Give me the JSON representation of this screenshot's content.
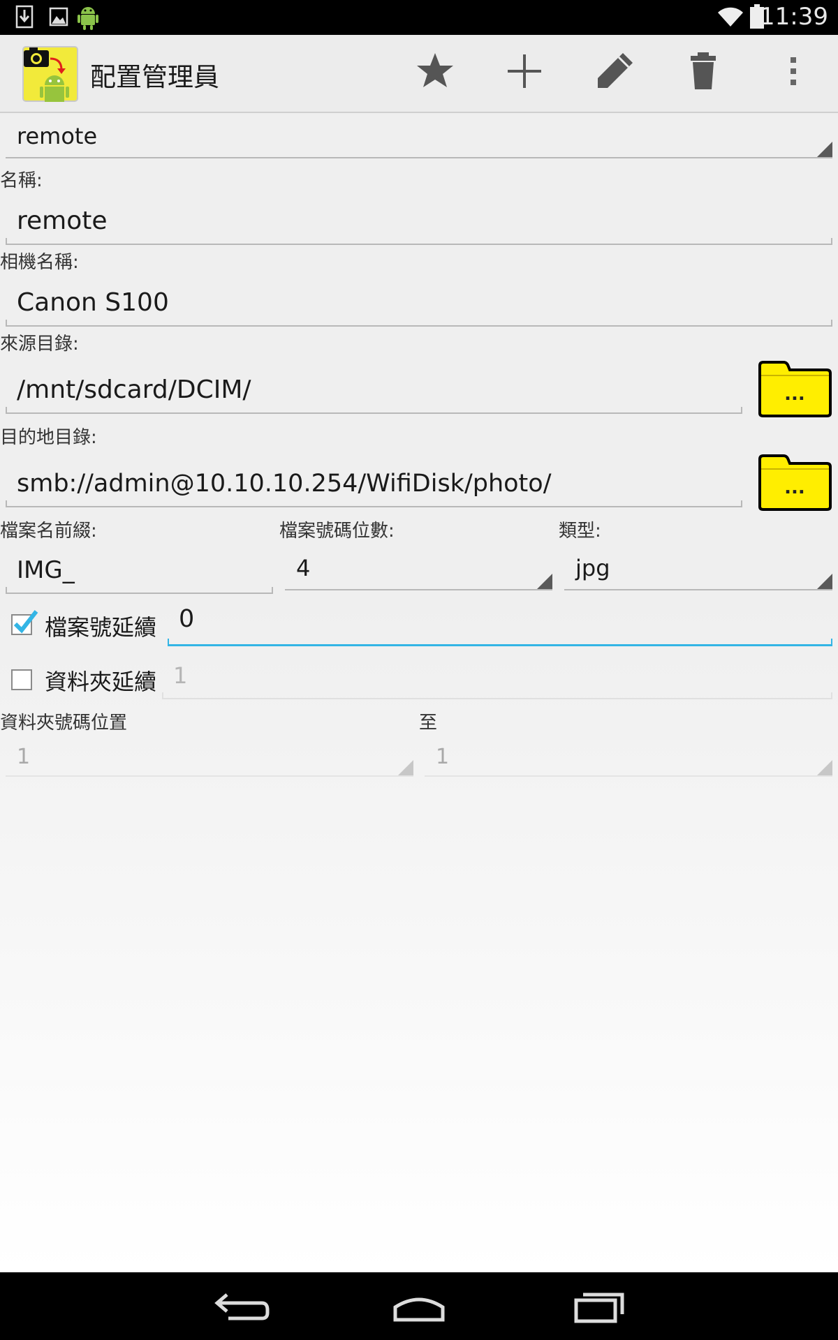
{
  "status_bar": {
    "time": "11:39",
    "icons": [
      "download-icon",
      "image-icon",
      "android-icon",
      "wifi-icon",
      "battery-icon"
    ]
  },
  "action_bar": {
    "title": "配置管理員",
    "icons": [
      "favorite-star-icon",
      "add-icon",
      "edit-pencil-icon",
      "delete-trash-icon",
      "overflow-menu-icon"
    ]
  },
  "profile_selector": {
    "value": "remote"
  },
  "form": {
    "name_label": "名稱:",
    "name_value": "remote",
    "camera_label": "相機名稱:",
    "camera_value": "Canon S100",
    "source_label": "來源目錄:",
    "source_value": "/mnt/sdcard/DCIM/",
    "dest_label": "目的地目錄:",
    "dest_value": "smb://admin@10.10.10.254/WifiDisk/photo/",
    "browse_label": "...",
    "prefix_label": "檔案名前綴:",
    "prefix_value": "IMG_",
    "digits_label": "檔案號碼位數:",
    "digits_value": "4",
    "type_label": "類型:",
    "type_value": "jpg",
    "file_continue_label": "檔案號延續",
    "file_continue_checked": true,
    "file_continue_value": "0",
    "folder_continue_label": "資料夾延續",
    "folder_continue_checked": false,
    "folder_continue_value": "1",
    "folder_pos_label": "資料夾號碼位置",
    "folder_pos_value": "1",
    "to_label": "至",
    "to_value": "1"
  },
  "colors": {
    "accent": "#33b5e5",
    "folder_yellow": "#ffee00",
    "checkmark": "#33b5e5"
  }
}
